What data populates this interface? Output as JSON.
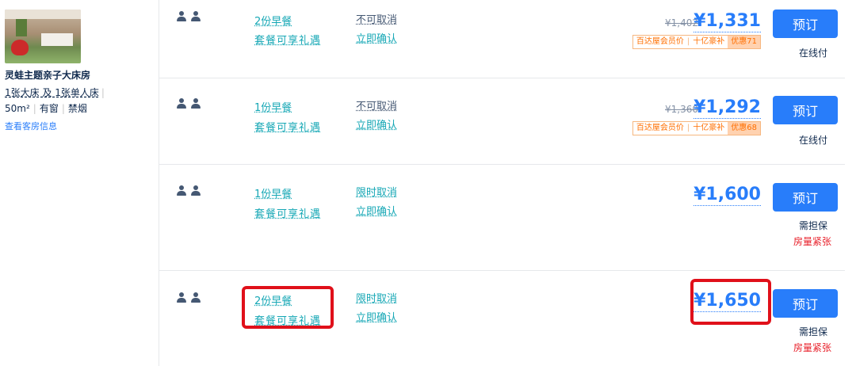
{
  "room": {
    "name": "灵蛙主题亲子大床房",
    "beds": "1张大床 及 1张单人床",
    "area": "50m²",
    "window": "有窗",
    "smoking": "禁烟",
    "details_link": "查看客房信息"
  },
  "rates": [
    {
      "meal": "2份早餐",
      "perk": "套餐可享礼遇",
      "cancel": "不可取消",
      "confirm": "立即确认",
      "old_price": "¥1,402",
      "price": "¥1,331",
      "promo": {
        "member": "百达屋会员价",
        "subsidy": "十亿豪补",
        "discount": "优惠71"
      },
      "book": "预订",
      "pay": "在线付"
    },
    {
      "meal": "1份早餐",
      "perk": "套餐可享礼遇",
      "cancel": "不可取消",
      "confirm": "立即确认",
      "old_price": "¥1,360",
      "price": "¥1,292",
      "promo": {
        "member": "百达屋会员价",
        "subsidy": "十亿豪补",
        "discount": "优惠68"
      },
      "book": "预订",
      "pay": "在线付"
    },
    {
      "meal": "1份早餐",
      "perk": "套餐可享礼遇",
      "cancel": "限时取消",
      "confirm": "立即确认",
      "price": "¥1,600",
      "book": "预订",
      "pay": "需担保",
      "status": "房量紧张"
    },
    {
      "meal": "2份早餐",
      "perk": "套餐可享礼遇",
      "cancel": "限时取消",
      "confirm": "立即确认",
      "price": "¥1,650",
      "book": "预订",
      "pay": "需担保",
      "status": "房量紧张"
    }
  ],
  "colors": {
    "accent": "#287dfa",
    "teal": "#15a7b5",
    "warning": "#e8212b",
    "highlight": "#e0101a"
  }
}
